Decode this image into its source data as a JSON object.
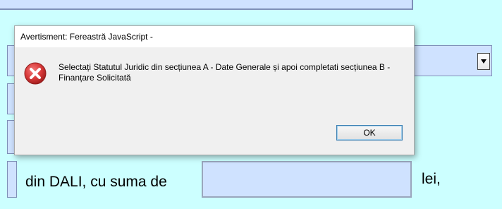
{
  "dialog": {
    "title": "Avertisment: Fereastră JavaScript -",
    "icon": "error-icon",
    "message": "Selectați Statutul Juridic din secțiunea A - Date Generale și apoi completati secțiunea B - Finanțare Solicitată",
    "ok_label": "OK"
  },
  "form": {
    "sum_text": "din DALI, cu suma de",
    "sum_value": "",
    "currency": "lei,"
  },
  "colors": {
    "page_background": "#ccffff",
    "field_background": "#cfe2ff",
    "dialog_background": "#f0f0f0",
    "error_red": "#d93a3a",
    "ok_border": "#3c7fb1"
  }
}
